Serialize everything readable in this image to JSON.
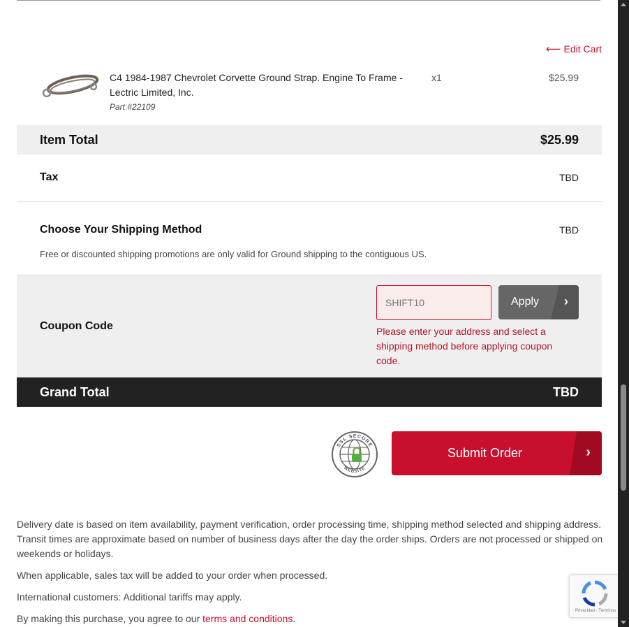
{
  "cart": {
    "edit_cart_label": "Edit Cart",
    "edit_cart_arrow": "⟵"
  },
  "item": {
    "name": "C4 1984-1987 Chevrolet Corvette Ground Strap. Engine To Frame - Lectric Limited, Inc.",
    "part_number": "Part #22109",
    "quantity": "x1",
    "price": "$25.99",
    "image_icon": "ground-strap-image"
  },
  "summary": {
    "item_total_label": "Item Total",
    "item_total_value": "$25.99",
    "tax_label": "Tax",
    "tax_value": "TBD",
    "shipping_label": "Choose Your Shipping Method",
    "shipping_value": "TBD",
    "shipping_note": "Free or discounted shipping promotions are only valid for Ground shipping to the contiguous US.",
    "grand_total_label": "Grand Total",
    "grand_total_value": "TBD"
  },
  "coupon": {
    "label": "Coupon Code",
    "placeholder": "SHIFT10",
    "value": "",
    "apply_label": "Apply",
    "error": "Please enter your address and select a shipping method before applying coupon code."
  },
  "submit": {
    "label": "Submit Order",
    "ssl_badge_top": "SSL SECURE",
    "ssl_badge_bottom": "WEBSITE"
  },
  "footer": {
    "delivery_note": "Delivery date is based on item availability, payment verification, order processing time, shipping method selected and shipping address. Transit times are approximate based on number of business days after the day the order ships. Orders are not processed or shipped on weekends or holidays.",
    "tax_note": "When applicable, sales tax will be added to your order when processed.",
    "intl_note": "International customers: Additional tariffs may apply.",
    "terms_prefix": "By making this purchase, you agree to our ",
    "terms_link": "terms and conditions",
    "terms_suffix": "."
  },
  "recaptcha": {
    "text": "Privacidad - Términos"
  },
  "colors": {
    "accent": "#c8102e",
    "grand_total_bg": "#222222",
    "row_bg": "#efefef"
  }
}
